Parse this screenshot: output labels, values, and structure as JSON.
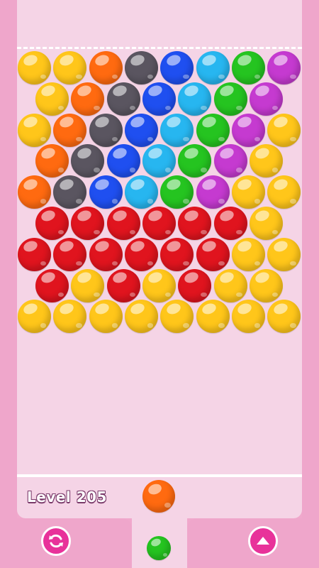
{
  "level": {
    "label": "Level 205"
  },
  "colors": {
    "yellow": "#ffc61a",
    "orange": "#ff6a10",
    "gray": "#5a5560",
    "blue": "#1f4ff0",
    "cyan": "#27b6f0",
    "green": "#25c420",
    "purple": "#c53ad0",
    "red": "#e0141e"
  },
  "grid": {
    "rows": [
      [
        "yellow",
        "yellow",
        "orange",
        "gray",
        "blue",
        "cyan",
        "green",
        "purple"
      ],
      [
        "yellow",
        "orange",
        "gray",
        "blue",
        "cyan",
        "green",
        "purple"
      ],
      [
        "yellow",
        "orange",
        "gray",
        "blue",
        "cyan",
        "green",
        "purple",
        "yellow"
      ],
      [
        "orange",
        "gray",
        "blue",
        "cyan",
        "green",
        "purple",
        "yellow"
      ],
      [
        "orange",
        "gray",
        "blue",
        "cyan",
        "green",
        "purple",
        "yellow",
        "yellow"
      ],
      [
        "red",
        "red",
        "red",
        "red",
        "red",
        "red",
        "yellow"
      ],
      [
        "red",
        "red",
        "red",
        "red",
        "red",
        "red",
        "yellow",
        "yellow"
      ],
      [
        "red",
        "yellow",
        "red",
        "yellow",
        "red",
        "yellow",
        "yellow"
      ],
      [
        "yellow",
        "yellow",
        "yellow",
        "yellow",
        "yellow",
        "yellow",
        "yellow",
        "yellow"
      ]
    ]
  },
  "shooter": {
    "current": "orange",
    "next": "green"
  },
  "buttons": {
    "swap": {
      "icon": "refresh-icon"
    },
    "boost": {
      "icon": "arrow-up-icon"
    }
  }
}
